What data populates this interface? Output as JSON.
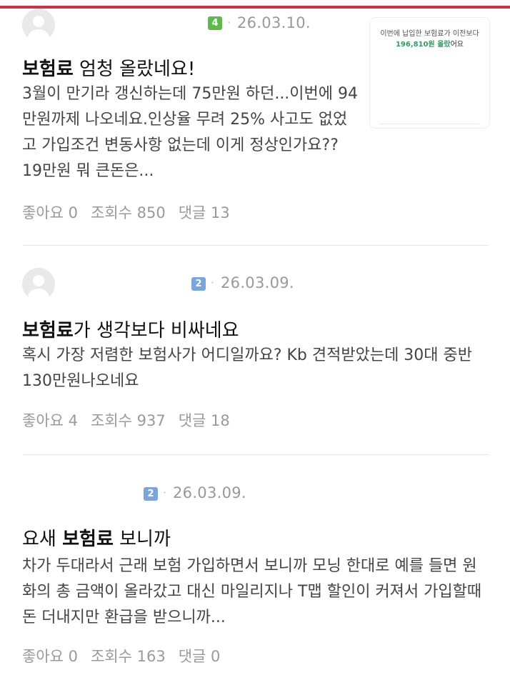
{
  "posts": [
    {
      "level": "4",
      "date": "26.03.10.",
      "title_highlight": "보험료",
      "title_rest": " 엄청 올랐네요!",
      "body": "3월이 만기라 갱신하는데 75만원 하던...이번에 94만원까제 나오네요.인상율 무려 25% 사고도 없었고 가입조건 변동사항 없는데 이게 정상인가요?? 19만원 뭐 큰돈은...",
      "likes": "좋아요 0",
      "views": "조회수 850",
      "comments": "댓글 13",
      "thumbnail": {
        "line1": "이번에 납입한 보험료가 이전보다",
        "amount": "196,810원 올랐",
        "suffix": "어요"
      }
    },
    {
      "level": "2",
      "date": "26.03.09.",
      "title_highlight": "보험료",
      "title_rest": "가 생각보다 비싸네요",
      "body": "혹시 가장 저렴한 보험사가 어디일까요? Kb 견적받았는데 30대 중반 130만원나오네요",
      "likes": "좋아요 4",
      "views": "조회수 937",
      "comments": "댓글 18"
    },
    {
      "level": "2",
      "date": "26.03.09.",
      "title_prefix": "요새 ",
      "title_highlight": "보험료",
      "title_rest": " 보니까",
      "body": "차가 두대라서 근래 보험 가입하면서 보니까 모닝 한대로 예를 들면 원화의 총 금액이 올라갔고 대신 마일리지나 T맵 할인이 커져서 가입할때 돈 더내지만 환급을 받으니까...",
      "likes": "좋아요 0",
      "views": "조회수 163",
      "comments": "댓글 0"
    }
  ],
  "colors": {
    "accent_bar": "#c8324a",
    "level_green": "#5dbb4a",
    "level_blue": "#7aa6e0",
    "thumb_green": "#2f9e60"
  },
  "icons": {
    "avatar": "default-profile-icon"
  }
}
